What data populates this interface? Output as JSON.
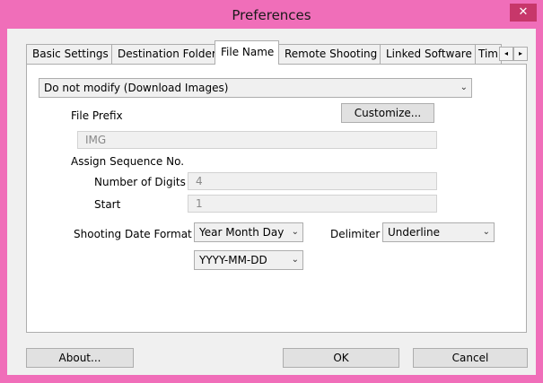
{
  "window": {
    "title": "Preferences",
    "close_glyph": "✕"
  },
  "tabs": [
    {
      "label": "Basic Settings"
    },
    {
      "label": "Destination Folder"
    },
    {
      "label": "File Name"
    },
    {
      "label": "Remote Shooting"
    },
    {
      "label": "Linked Software"
    },
    {
      "label": "Tim"
    }
  ],
  "tab_scroll": {
    "left": "◂",
    "right": "▸"
  },
  "file_name": {
    "mode_value": "Do not modify (Download Images)",
    "file_prefix_label": "File Prefix",
    "customize_label": "Customize...",
    "prefix_value": "IMG",
    "assign_sequence_label": "Assign Sequence No.",
    "num_digits_label": "Number of Digits",
    "num_digits_value": "4",
    "start_label": "Start",
    "start_value": "1",
    "date_format_label": "Shooting Date Format",
    "date_order_value": "Year Month Day",
    "date_pattern_value": "YYYY-MM-DD",
    "delimiter_label": "Delimiter",
    "delimiter_value": "Underline"
  },
  "footer": {
    "about_label": "About...",
    "ok_label": "OK",
    "cancel_label": "Cancel"
  },
  "colors": {
    "titlebar": "#f06eb9",
    "close": "#c7376a",
    "dialog_bg": "#f0f0f0"
  }
}
